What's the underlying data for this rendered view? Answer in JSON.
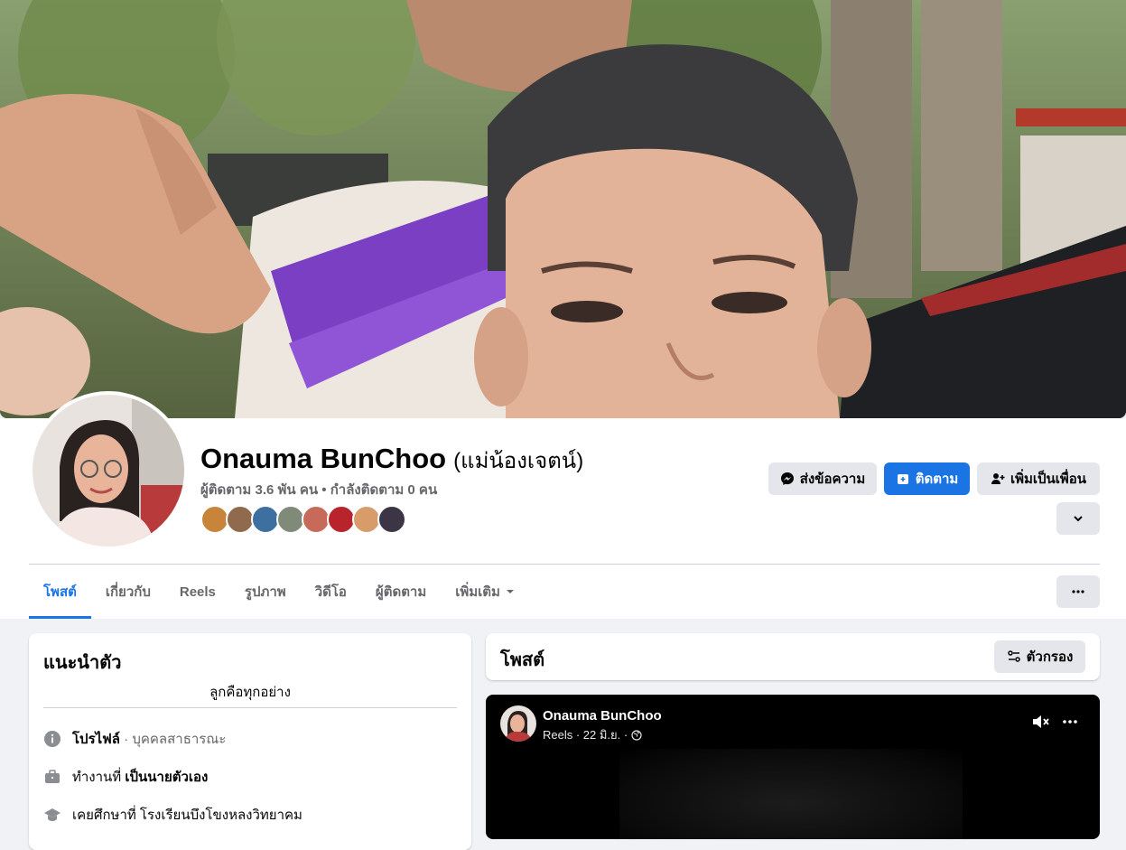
{
  "profile": {
    "name": "Onauma BunChoo",
    "alt_name": "(แม่น้องเจตน์)",
    "followers_text": "ผู้ติดตาม 3.6 พัน คน • กำลังติดตาม 0 คน"
  },
  "actions": {
    "message_label": "ส่งข้อความ",
    "follow_label": "ติดตาม",
    "add_friend_label": "เพิ่มเป็นเพื่อน"
  },
  "tabs": [
    {
      "label": "โพสต์"
    },
    {
      "label": "เกี่ยวกับ"
    },
    {
      "label": "Reels"
    },
    {
      "label": "รูปภาพ"
    },
    {
      "label": "วิดีโอ"
    },
    {
      "label": "ผู้ติดตาม"
    },
    {
      "label": "เพิ่มเติม"
    }
  ],
  "intro": {
    "title": "แนะนำตัว",
    "bio": "ลูกคือทุกอย่าง",
    "profile_label": "โปรไฟล์",
    "profile_type": " · บุคคลสาธารณะ",
    "work_prefix": "ทำงานที่ ",
    "work_value": "เป็นนายตัวเอง",
    "study_text": "เคยศึกษาที่ โรงเรียนบึงโขงหลงวิทยาคม"
  },
  "posts": {
    "title": "โพสต์",
    "filter_label": "ตัวกรอง"
  },
  "reel": {
    "author": "Onauma BunChoo",
    "meta": "Reels · 22 มิ.ย. ·"
  },
  "colors": {
    "accent": "#1b74e4",
    "page_bg": "#f0f2f5"
  }
}
